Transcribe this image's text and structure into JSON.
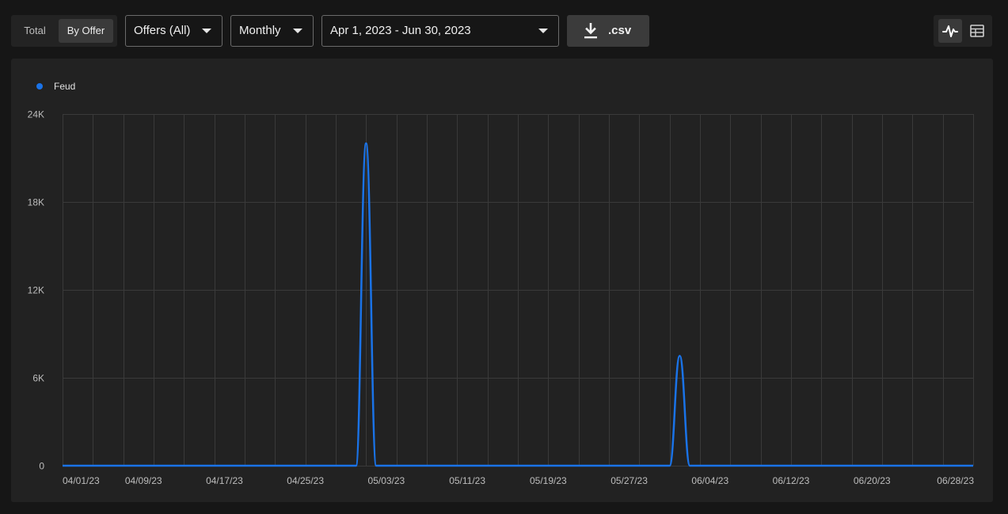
{
  "toolbar": {
    "group_total": "Total",
    "group_by_offer": "By Offer",
    "offers_select": "Offers (All)",
    "period_select": "Monthly",
    "date_range": "Apr 1, 2023 - Jun 30, 2023",
    "csv_label": ".csv",
    "download_icon": "download-icon",
    "chart_view_icon": "line-chart-icon",
    "table_view_icon": "table-icon"
  },
  "chart_data": {
    "type": "line",
    "series": [
      {
        "name": "Feud",
        "color": "#1a73e8",
        "points": [
          [
            "04/01/23",
            0
          ],
          [
            "04/30/23",
            0
          ],
          [
            "05/01/23",
            22000
          ],
          [
            "05/02/23",
            0
          ],
          [
            "05/31/23",
            0
          ],
          [
            "06/01/23",
            7500
          ],
          [
            "06/02/23",
            0
          ],
          [
            "06/30/23",
            0
          ]
        ]
      }
    ],
    "x_tick_labels": [
      "04/01/23",
      "04/09/23",
      "04/17/23",
      "04/25/23",
      "05/03/23",
      "05/11/23",
      "05/19/23",
      "05/27/23",
      "06/04/23",
      "06/12/23",
      "06/20/23",
      "06/28/23"
    ],
    "y_tick_labels": [
      "0",
      "6K",
      "12K",
      "18K",
      "24K"
    ],
    "y_ticks": [
      0,
      6000,
      12000,
      18000,
      24000
    ],
    "xlim": [
      "04/01/23",
      "06/30/23"
    ],
    "ylim": [
      0,
      24000
    ],
    "grid": true,
    "legend_position": "top-left"
  }
}
